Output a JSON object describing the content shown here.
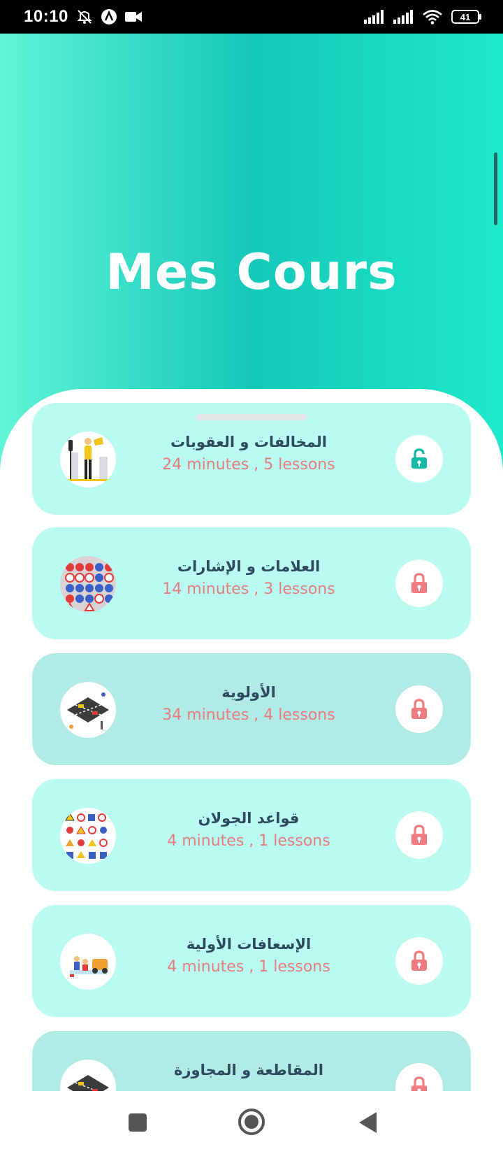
{
  "status_bar": {
    "time": "10:10",
    "battery": "41",
    "icons": [
      "alarm-off-icon",
      "a-circle-icon",
      "video-camera-icon",
      "signal-icon",
      "signal-icon",
      "wifi-icon",
      "battery-icon"
    ]
  },
  "header": {
    "title": "Mes Cours"
  },
  "courses": [
    {
      "title": "المخالفات و العقوبات",
      "meta": "24 minutes , 5 lessons",
      "status": "unlocked",
      "thumb": "person-traffic-light-illustration"
    },
    {
      "title": "العلامات و الإشارات",
      "meta": "14 minutes , 3 lessons",
      "status": "locked",
      "thumb": "road-signs-grid-illustration"
    },
    {
      "title": "الأولوية",
      "meta": "34 minutes , 4 lessons",
      "status": "locked",
      "thumb": "intersection-illustration"
    },
    {
      "title": "قواعد الجولان",
      "meta": "4 minutes , 1 lessons",
      "status": "locked",
      "thumb": "traffic-signs-illustration"
    },
    {
      "title": "الإسعافات الأولية",
      "meta": "4 minutes , 1 lessons",
      "status": "locked",
      "thumb": "first-aid-illustration"
    },
    {
      "title": "المقاطعة و المجاوزة",
      "meta": "",
      "status": "locked",
      "thumb": "intersection-illustration"
    }
  ],
  "colors": {
    "hero_gradient": [
      "#5ff4d6",
      "#14c8b8",
      "#1ee9cb"
    ],
    "card_light": "#b9fbf1",
    "card_dark": "#b1ebe5",
    "title_text": "#2e4a5e",
    "meta_text": "#e67e7e",
    "unlock_icon": "#16b8a8",
    "lock_icon": "#ef7b80"
  },
  "nav": {
    "icons": [
      "recent-apps-icon",
      "home-icon",
      "back-icon"
    ]
  }
}
